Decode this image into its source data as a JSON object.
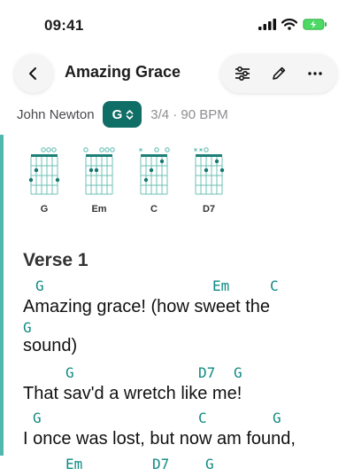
{
  "status": {
    "time": "09:41"
  },
  "header": {
    "title": "Amazing Grace"
  },
  "meta": {
    "author": "John Newton",
    "key": "G",
    "tempo": "3/4 · 90 BPM"
  },
  "chords": [
    {
      "name": "G"
    },
    {
      "name": "Em"
    },
    {
      "name": "C"
    },
    {
      "name": "D7"
    }
  ],
  "section": {
    "title": "Verse 1"
  },
  "lines": [
    {
      "chords": [
        "G",
        "Em",
        "C"
      ],
      "lyric": "Amazing grace! (how sweet the"
    },
    {
      "chords": [
        "G"
      ],
      "lyric": "sound)"
    },
    {
      "chords": [
        "G",
        "D7",
        "G"
      ],
      "lyric": "That sav'd a wretch like me!"
    },
    {
      "chords": [
        "G",
        "C",
        "G"
      ],
      "lyric": "I once was lost, but now am found,"
    },
    {
      "chords": [
        "Em",
        "D7",
        "G"
      ],
      "lyric": ""
    }
  ],
  "colors": {
    "accent": "#0f6e66",
    "chord_text": "#0f8a82",
    "rail": "#52b7ac"
  },
  "icons": [
    "back-chevron-icon",
    "sliders-icon",
    "pencil-icon",
    "more-icon",
    "chevron-updown-icon"
  ]
}
